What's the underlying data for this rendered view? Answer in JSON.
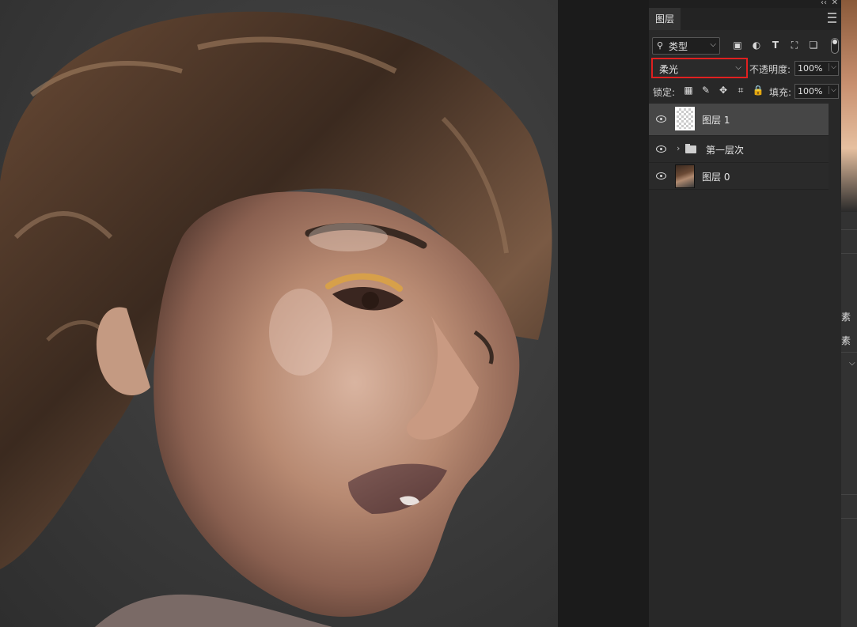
{
  "panel": {
    "tab_label": "图层",
    "filter_label": "类型",
    "blend_mode": "柔光",
    "opacity_label": "不透明度:",
    "opacity_value": "100%",
    "lock_label": "锁定:",
    "fill_label": "填充:",
    "fill_value": "100%"
  },
  "layers": [
    {
      "name": "图层",
      "num": "1",
      "selected": true,
      "type": "transparent"
    },
    {
      "name": "第一层次",
      "type": "group"
    },
    {
      "name": "图层",
      "num": "0",
      "type": "photo"
    }
  ],
  "right_strip": {
    "text1": "素",
    "text2": "素"
  },
  "colors": {
    "highlight_border": "#e02020",
    "selected_row": "#464646",
    "panel_bg": "#282828"
  }
}
